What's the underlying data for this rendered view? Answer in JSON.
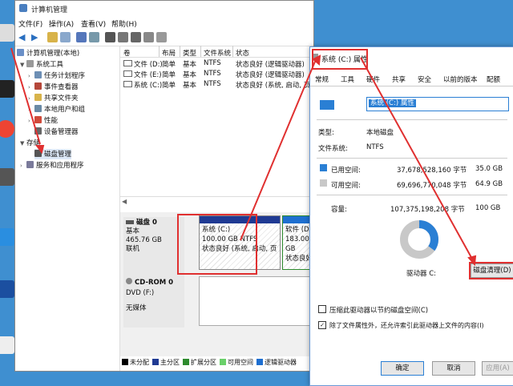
{
  "window": {
    "title": "计算机管理",
    "menu": [
      "文件(F)",
      "操作(A)",
      "查看(V)",
      "帮助(H)"
    ]
  },
  "tree": [
    {
      "label": "计算机管理(本地)",
      "icon": "computer-management-icon"
    },
    {
      "label": "系统工具",
      "icon": "tools-icon"
    },
    {
      "label": "任务计划程序",
      "icon": "task-scheduler-icon"
    },
    {
      "label": "事件查看器",
      "icon": "event-viewer-icon"
    },
    {
      "label": "共享文件夹",
      "icon": "shared-folder-icon"
    },
    {
      "label": "本地用户和组",
      "icon": "users-icon"
    },
    {
      "label": "性能",
      "icon": "performance-icon"
    },
    {
      "label": "设备管理器",
      "icon": "device-manager-icon"
    },
    {
      "label": "存储",
      "icon": "storage-icon"
    },
    {
      "label": "磁盘管理",
      "icon": "disk-management-icon"
    },
    {
      "label": "服务和应用程序",
      "icon": "services-icon"
    }
  ],
  "volume_table": {
    "headers": [
      "卷",
      "布局",
      "类型",
      "文件系统",
      "状态"
    ],
    "rows": [
      [
        "文件 (D:)",
        "简单",
        "基本",
        "NTFS",
        "状态良好 (逻辑驱动器)"
      ],
      [
        "文件 (E:)",
        "简单",
        "基本",
        "NTFS",
        "状态良好 (逻辑驱动器)"
      ],
      [
        "系统 (C:)",
        "简单",
        "基本",
        "NTFS",
        "状态良好 (系统, 启动, 页面"
      ]
    ]
  },
  "disks": {
    "disk0": {
      "name": "磁盘 0",
      "type": "基本",
      "size": "465.76 GB",
      "status": "联机"
    },
    "c": {
      "name": "系统 (C:)",
      "size": "100.00 GB NTFS",
      "status": "状态良好 (系统, 启动, 页"
    },
    "d": {
      "name": "软件 (D:)",
      "size": "183.00 GB",
      "status": "状态良好"
    },
    "cdrom": {
      "name": "CD-ROM 0",
      "type": "DVD (F:)",
      "media": "无媒体"
    }
  },
  "legend": [
    {
      "label": "未分配",
      "color": "#000000"
    },
    {
      "label": "主分区",
      "color": "#1f3a93"
    },
    {
      "label": "扩展分区",
      "color": "#2e8b2e"
    },
    {
      "label": "可用空间",
      "color": "#6ad06a"
    },
    {
      "label": "逻辑驱动器",
      "color": "#1e6fd0"
    }
  ],
  "props": {
    "title": "系统 (C:) 属性",
    "tabs": [
      "常规",
      "工具",
      "硬件",
      "共享",
      "安全",
      "以前的版本",
      "配额"
    ],
    "type_label": "类型:",
    "type_value": "本地磁盘",
    "fs_label": "文件系统:",
    "fs_value": "NTFS",
    "used_label": "已用空间:",
    "used_bytes": "37,678,528,160 字节",
    "used_gb": "35.0 GB",
    "free_label": "可用空间:",
    "free_bytes": "69,696,770,048 字节",
    "free_gb": "64.9 GB",
    "cap_label": "容量:",
    "cap_bytes": "107,375,198,208 字节",
    "cap_gb": "100 GB",
    "drive_label": "驱动器 C:",
    "cleanup": "磁盘清理(D)",
    "compress": "压缩此驱动器以节约磁盘空间(C)",
    "index": "除了文件属性外，还允许索引此驱动器上文件的内容(I)",
    "ok": "确定",
    "cancel": "取消",
    "apply": "应用(A)",
    "used_fraction": 0.35,
    "used_color": "#2a7fd4",
    "free_color": "#c8c8c8"
  }
}
